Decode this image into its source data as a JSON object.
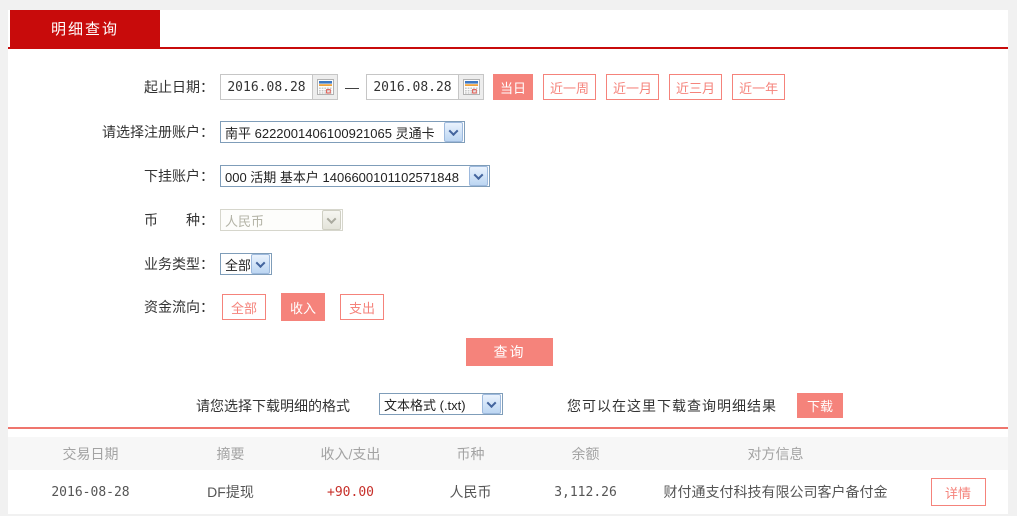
{
  "tab": {
    "label": "明细查询"
  },
  "form": {
    "date_range": {
      "label": "起止日期：",
      "start": "2016.08.28",
      "end": "2016.08.28",
      "separator": "—",
      "quick_buttons": [
        {
          "label": "当日",
          "active": true
        },
        {
          "label": "近一周",
          "active": false
        },
        {
          "label": "近一月",
          "active": false
        },
        {
          "label": "近三月",
          "active": false
        },
        {
          "label": "近一年",
          "active": false
        }
      ]
    },
    "registered_account": {
      "label": "请选择注册账户：",
      "value": "南平 6222001406100921065 灵通卡"
    },
    "sub_account": {
      "label": "下挂账户：",
      "value": "000 活期 基本户 1406600101102571848"
    },
    "currency": {
      "label": "币　　种：",
      "value": "人民币",
      "disabled": true
    },
    "business_type": {
      "label": "业务类型：",
      "value": "全部"
    },
    "fund_direction": {
      "label": "资金流向：",
      "options": [
        {
          "label": "全部",
          "active": false
        },
        {
          "label": "收入",
          "active": true
        },
        {
          "label": "支出",
          "active": false
        }
      ]
    },
    "query_button": "查询",
    "download": {
      "format_label": "请您选择下载明细的格式",
      "format_value": "文本格式 (.txt)",
      "hint": "您可以在这里下载查询明细结果",
      "button": "下载"
    }
  },
  "table": {
    "headers": [
      "交易日期",
      "摘要",
      "收入/支出",
      "币种",
      "余额",
      "对方信息"
    ],
    "rows": [
      {
        "date": "2016-08-28",
        "summary": "DF提现",
        "amount": "+90.00",
        "currency": "人民币",
        "balance": "3,112.26",
        "counterparty": "财付通支付科技有限公司客户备付金",
        "action": "详情"
      }
    ]
  },
  "colors": {
    "tab_red": "#c80b0b",
    "accent_salmon": "#f5837b",
    "separator": "#ef756d",
    "amount_red": "#c7302a",
    "page_bg": "#f1f1f1"
  }
}
